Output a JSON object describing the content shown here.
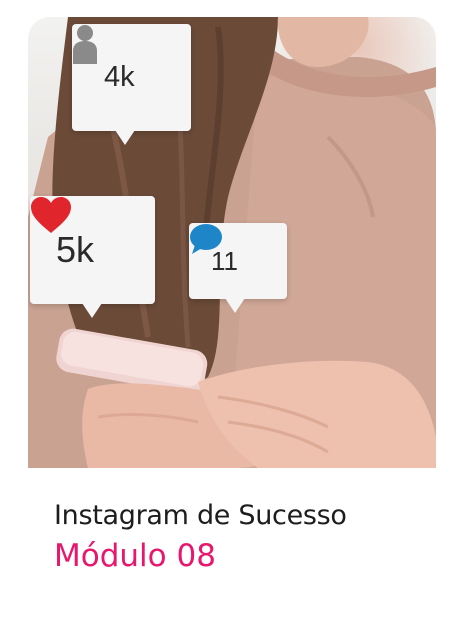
{
  "photo": {
    "notifications": {
      "followers": {
        "icon": "person-icon",
        "count": "4k"
      },
      "likes": {
        "icon": "heart-icon",
        "count": "5k"
      },
      "comments": {
        "icon": "comment-icon",
        "count": "11"
      }
    }
  },
  "caption": {
    "title": "Instagram de Sucesso",
    "subtitle": "Módulo 08"
  },
  "colors": {
    "accent": "#e8176d",
    "title_text": "#1d1d1d",
    "heart": "#e0262c",
    "comment": "#1e86c8",
    "person": "#8a8a8a",
    "bubble_bg": "#f4f5f4"
  }
}
